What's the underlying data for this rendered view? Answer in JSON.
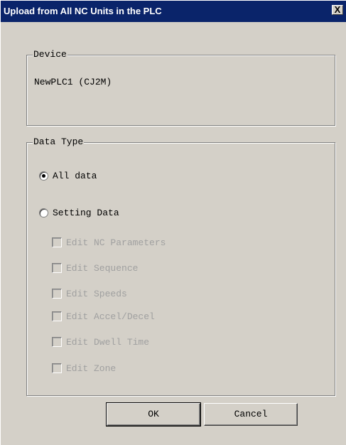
{
  "window": {
    "title": "Upload from All NC Units in the PLC",
    "close_label": "X"
  },
  "device_group": {
    "legend": "Device",
    "value": "NewPLC1 (CJ2M)"
  },
  "data_type_group": {
    "legend": "Data Type",
    "radios": [
      {
        "label": "All data",
        "checked": true
      },
      {
        "label": "Setting Data",
        "checked": false
      }
    ],
    "checkboxes": [
      {
        "label": "Edit NC Parameters",
        "checked": false,
        "enabled": false
      },
      {
        "label": "Edit Sequence",
        "checked": false,
        "enabled": false
      },
      {
        "label": "Edit Speeds",
        "checked": false,
        "enabled": false
      },
      {
        "label": "Edit Accel/Decel",
        "checked": false,
        "enabled": false
      },
      {
        "label": "Edit Dwell Time",
        "checked": false,
        "enabled": false
      },
      {
        "label": "Edit Zone",
        "checked": false,
        "enabled": false
      }
    ]
  },
  "buttons": {
    "ok_label": "OK",
    "cancel_label": "Cancel"
  },
  "colors": {
    "titlebar": "#0a246a",
    "dialog_bg": "#d4d0c8",
    "disabled_text": "#a0a0a0"
  }
}
